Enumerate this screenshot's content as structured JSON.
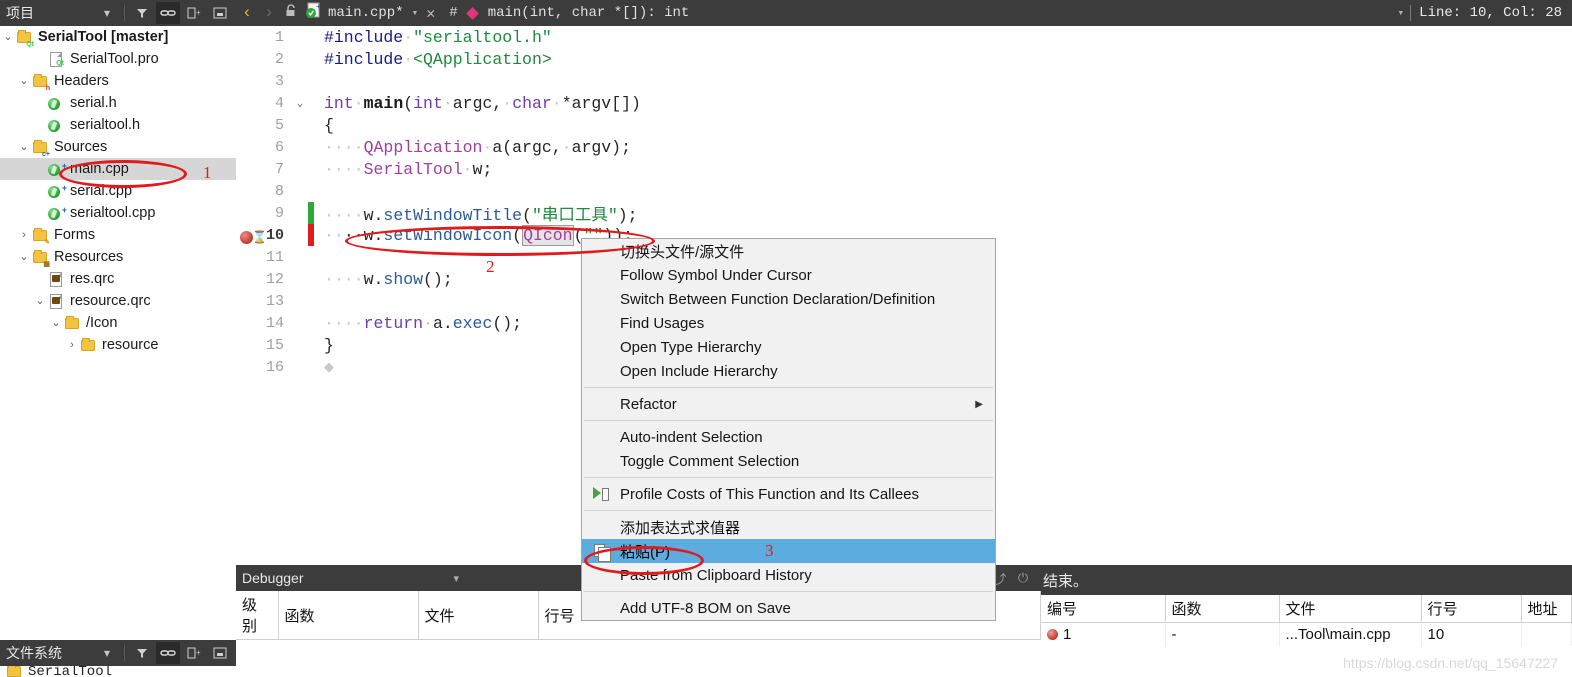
{
  "project_panel": {
    "title": "项目",
    "icons": [
      "chevron-down-icon",
      "filter-icon",
      "link-icon",
      "split-icon",
      "collapse-icon"
    ],
    "tree": [
      {
        "label": "SerialTool [master]",
        "depth": 0,
        "icon": "folder-qt",
        "arrow": "v",
        "bold": true
      },
      {
        "label": "SerialTool.pro",
        "depth": 2,
        "icon": "file-pro",
        "arrow": ""
      },
      {
        "label": "Headers",
        "depth": 1,
        "icon": "folder-h",
        "arrow": "v"
      },
      {
        "label": "serial.h",
        "depth": 2,
        "icon": "file-h",
        "arrow": ""
      },
      {
        "label": "serialtool.h",
        "depth": 2,
        "icon": "file-h",
        "arrow": ""
      },
      {
        "label": "Sources",
        "depth": 1,
        "icon": "folder-cpp",
        "arrow": "v"
      },
      {
        "label": "main.cpp",
        "depth": 2,
        "icon": "file-cpp",
        "arrow": "",
        "selected": true,
        "annotation": "1"
      },
      {
        "label": "serial.cpp",
        "depth": 2,
        "icon": "file-cpp",
        "arrow": ""
      },
      {
        "label": "serialtool.cpp",
        "depth": 2,
        "icon": "file-cpp",
        "arrow": ""
      },
      {
        "label": "Forms",
        "depth": 1,
        "icon": "folder-ui",
        "arrow": ">"
      },
      {
        "label": "Resources",
        "depth": 1,
        "icon": "folder-res",
        "arrow": "v"
      },
      {
        "label": "res.qrc",
        "depth": 2,
        "icon": "file-qrc",
        "arrow": ""
      },
      {
        "label": "resource.qrc",
        "depth": 2,
        "icon": "file-qrc",
        "arrow": "v"
      },
      {
        "label": "/Icon",
        "depth": 3,
        "icon": "folder-plain",
        "arrow": "v"
      },
      {
        "label": "resource",
        "depth": 4,
        "icon": "folder-plain",
        "arrow": ">"
      }
    ]
  },
  "editor_header": {
    "back_icon": "chevron-left-icon",
    "forward_icon": "chevron-right-icon",
    "lock_icon": "unlocked-icon",
    "file_icon": "cpp-file-icon",
    "filename": "main.cpp*",
    "dropdown_icon": "chevron-down-icon",
    "close_icon": "close-icon",
    "hash_icon": "#",
    "symbol_icon": "diamond-icon",
    "symbol": "main(int, char *[]): int",
    "symbol_dropdown_icon": "chevron-down-icon",
    "line_col": "Line: 10, Col: 28"
  },
  "code": {
    "lines": [
      {
        "n": "1",
        "fold": "",
        "tokens": [
          {
            "t": "#include",
            "c": "inc"
          },
          {
            "t": "·",
            "c": "dot"
          },
          {
            "t": "\"serialtool.h\"",
            "c": "str"
          }
        ]
      },
      {
        "n": "2",
        "fold": "",
        "tokens": [
          {
            "t": "#include",
            "c": "inc"
          },
          {
            "t": "·",
            "c": "dot"
          },
          {
            "t": "<QApplication>",
            "c": "str"
          }
        ]
      },
      {
        "n": "3",
        "fold": "",
        "tokens": []
      },
      {
        "n": "4",
        "fold": "v",
        "tokens": [
          {
            "t": "int",
            "c": "kw"
          },
          {
            "t": "·",
            "c": "dot"
          },
          {
            "t": "main",
            "c": "fn"
          },
          {
            "t": "(",
            "c": "nrm"
          },
          {
            "t": "int",
            "c": "kw"
          },
          {
            "t": "·",
            "c": "dot"
          },
          {
            "t": "argc",
            "c": "nrm"
          },
          {
            "t": ",",
            "c": "nrm"
          },
          {
            "t": "·",
            "c": "dot"
          },
          {
            "t": "char",
            "c": "kw"
          },
          {
            "t": "·",
            "c": "dot"
          },
          {
            "t": "*argv[])",
            "c": "nrm"
          }
        ]
      },
      {
        "n": "5",
        "fold": "",
        "tokens": [
          {
            "t": "{",
            "c": "nrm"
          }
        ]
      },
      {
        "n": "6",
        "fold": "",
        "tokens": [
          {
            "t": "····",
            "c": "dot"
          },
          {
            "t": "QApplication",
            "c": "cls"
          },
          {
            "t": "·",
            "c": "dot"
          },
          {
            "t": "a(argc,",
            "c": "nrm"
          },
          {
            "t": "·",
            "c": "dot"
          },
          {
            "t": "argv);",
            "c": "nrm"
          }
        ]
      },
      {
        "n": "7",
        "fold": "",
        "tokens": [
          {
            "t": "····",
            "c": "dot"
          },
          {
            "t": "SerialTool",
            "c": "cls"
          },
          {
            "t": "·",
            "c": "dot"
          },
          {
            "t": "w;",
            "c": "nrm"
          }
        ]
      },
      {
        "n": "8",
        "fold": "",
        "tokens": []
      },
      {
        "n": "9",
        "fold": "",
        "mark": "green",
        "tokens": [
          {
            "t": "····",
            "c": "dot"
          },
          {
            "t": "w.",
            "c": "nrm"
          },
          {
            "t": "setWindowTitle",
            "c": "kw2"
          },
          {
            "t": "(",
            "c": "nrm"
          },
          {
            "t": "\"串口工具\"",
            "c": "str"
          },
          {
            "t": ");",
            "c": "nrm"
          }
        ]
      },
      {
        "n": "10",
        "fold": "",
        "current": true,
        "breakpoint": true,
        "mark": "red",
        "tokens": [
          {
            "t": "··",
            "c": "dot"
          },
          {
            "t": "··w.",
            "c": "nrm"
          },
          {
            "t": "setWindowIcon",
            "c": "kw2"
          },
          {
            "t": "(",
            "c": "nrm"
          },
          {
            "t": "QIcon",
            "c": "cls",
            "boxed": true
          },
          {
            "t": "(",
            "c": "nrm"
          },
          {
            "t": "\"\"",
            "c": "str"
          },
          {
            "t": "));",
            "c": "nrm"
          }
        ]
      },
      {
        "n": "11",
        "fold": "",
        "tokens": []
      },
      {
        "n": "12",
        "fold": "",
        "tokens": [
          {
            "t": "····",
            "c": "dot"
          },
          {
            "t": "w.",
            "c": "nrm"
          },
          {
            "t": "show",
            "c": "kw2"
          },
          {
            "t": "();",
            "c": "nrm"
          }
        ]
      },
      {
        "n": "13",
        "fold": "",
        "tokens": []
      },
      {
        "n": "14",
        "fold": "",
        "tokens": [
          {
            "t": "····",
            "c": "dot"
          },
          {
            "t": "return",
            "c": "kw"
          },
          {
            "t": "·",
            "c": "dot"
          },
          {
            "t": "a.",
            "c": "nrm"
          },
          {
            "t": "exec",
            "c": "kw2"
          },
          {
            "t": "();",
            "c": "nrm"
          }
        ]
      },
      {
        "n": "15",
        "fold": "",
        "tokens": [
          {
            "t": "}",
            "c": "nrm"
          }
        ]
      },
      {
        "n": "16",
        "fold": "",
        "tokens": [
          {
            "t": "◆",
            "c": "dot"
          }
        ]
      }
    ]
  },
  "context_menu": {
    "items": [
      {
        "label": "切换头文件/源文件",
        "icon": ""
      },
      {
        "label": "Follow Symbol Under Cursor",
        "icon": ""
      },
      {
        "label": "Switch Between Function Declaration/Definition",
        "icon": ""
      },
      {
        "label": "Find Usages",
        "icon": ""
      },
      {
        "label": "Open Type Hierarchy",
        "icon": ""
      },
      {
        "label": "Open Include Hierarchy",
        "icon": ""
      },
      {
        "separator": true
      },
      {
        "label": "Refactor",
        "icon": "",
        "submenu": "▶"
      },
      {
        "separator": true
      },
      {
        "label": "Auto-indent Selection",
        "icon": ""
      },
      {
        "label": "Toggle Comment Selection",
        "icon": ""
      },
      {
        "separator": true
      },
      {
        "label": "Profile Costs of This Function and Its Callees",
        "icon": "profile-icon"
      },
      {
        "separator": true
      },
      {
        "label": "添加表达式求值器",
        "icon": ""
      },
      {
        "label": "粘贴(P)",
        "icon": "clipboard-icon",
        "highlighted": true,
        "annotation": "3"
      },
      {
        "label": "Paste from Clipboard History",
        "icon": ""
      },
      {
        "separator": true
      },
      {
        "label": "Add UTF-8 BOM on Save",
        "icon": ""
      }
    ]
  },
  "debugger_panel": {
    "title": "Debugger",
    "dropdown_icon": "chevron-down-icon",
    "tool_icons": [
      "continue-icon",
      "stop-icon",
      "step-over-icon",
      "step-into-icon",
      "step-out-icon",
      "power-icon"
    ],
    "columns": [
      "级别",
      "函数",
      "文件",
      "行号"
    ],
    "rows": []
  },
  "breakpoint_panel": {
    "status_text": "结束。",
    "columns": [
      "编号",
      "函数",
      "文件",
      "行号",
      "地址"
    ],
    "rows": [
      {
        "编号": "1",
        "函数": "-",
        "文件": "...Tool\\main.cpp",
        "行号": "10",
        "地址": ""
      }
    ]
  },
  "filesystem_panel": {
    "title": "文件系统",
    "icons": [
      "chevron-down-icon",
      "filter-icon",
      "link-icon",
      "split-icon",
      "collapse-icon"
    ],
    "first_row": "SerialTool"
  },
  "watermark": "https://blog.csdn.net/qq_15647227",
  "annotations": {
    "one": "1",
    "two": "2",
    "three": "3",
    "color": "#e01b1b"
  }
}
